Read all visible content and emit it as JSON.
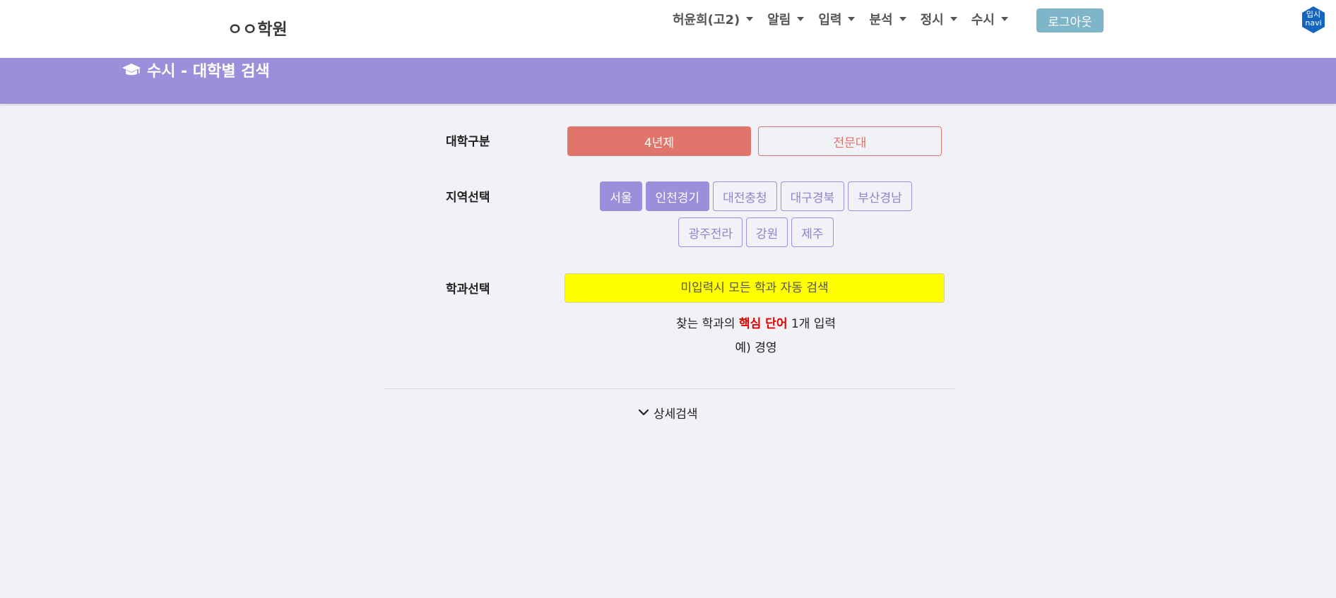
{
  "navbar": {
    "brand": "ㅇㅇ학원",
    "menu": [
      {
        "label": "허윤희(고2)"
      },
      {
        "label": "알림"
      },
      {
        "label": "입력"
      },
      {
        "label": "분석"
      },
      {
        "label": "정시"
      },
      {
        "label": "수시"
      }
    ],
    "logout_label": "로그아웃",
    "logo": {
      "line1": "입시",
      "line2": "navi",
      "color": "#1565c0"
    }
  },
  "header": {
    "title": "수시 - 대학별 검색",
    "icon": "graduation-cap-icon",
    "color": "#9b8fdb"
  },
  "form": {
    "university_type": {
      "label": "대학구분",
      "options": [
        "4년제",
        "전문대"
      ],
      "selected": "4년제"
    },
    "region": {
      "label": "지역선택",
      "options": [
        "서울",
        "인천경기",
        "대전충청",
        "대구경북",
        "부산경남",
        "광주전라",
        "강원",
        "제주"
      ],
      "selected": [
        "서울",
        "인천경기"
      ]
    },
    "department": {
      "label": "학과선택",
      "placeholder": "미입력시 모든 학과 자동 검색",
      "value": "",
      "hint_before": "찾는 학과의 ",
      "hint_keyword": "핵심 단어",
      "hint_after": " 1개 입력",
      "example": "예) 경영"
    },
    "detail_search_label": "상세검색"
  },
  "colors": {
    "accent_purple": "#9b8fdb",
    "accent_red": "#e0756b",
    "input_highlight": "#ffff00",
    "logout_button": "#7eb5c9",
    "keyword_red": "#e00000"
  }
}
